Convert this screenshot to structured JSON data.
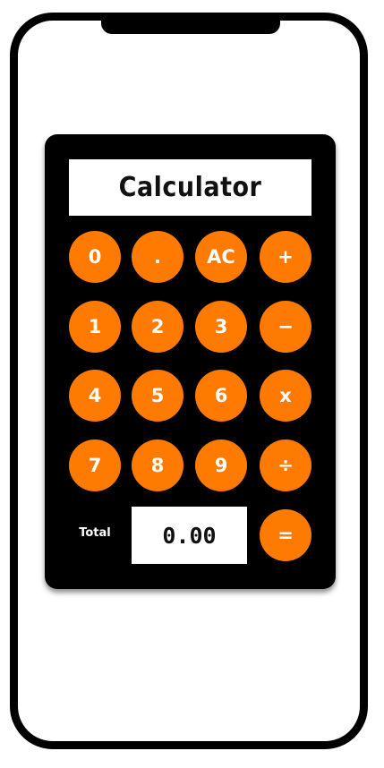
{
  "title": "Calculator",
  "keys": {
    "zero": "0",
    "dot": ".",
    "clear": "AC",
    "plus": "+",
    "one": "1",
    "two": "2",
    "three": "3",
    "minus": "−",
    "four": "4",
    "five": "5",
    "six": "6",
    "times": "x",
    "seven": "7",
    "eight": "8",
    "nine": "9",
    "divide": "÷",
    "equals": "="
  },
  "total": {
    "label": "Total",
    "value": "0.00"
  },
  "colors": {
    "accent": "#ff7a00",
    "body": "#000000",
    "display": "#ffffff"
  }
}
